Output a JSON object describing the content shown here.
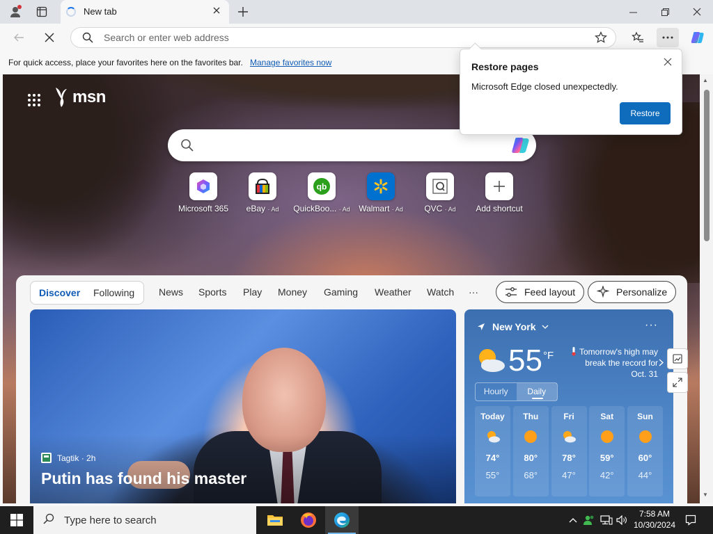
{
  "browser": {
    "tab_title": "New tab",
    "address_placeholder": "Search or enter web address",
    "favorites_hint": "For quick access, place your favorites here on the favorites bar.",
    "favorites_link": "Manage favorites now"
  },
  "restore_popup": {
    "title": "Restore pages",
    "message": "Microsoft Edge closed unexpectedly.",
    "button": "Restore"
  },
  "msn": {
    "logo_text": "msn",
    "shortcuts": [
      {
        "label": "Microsoft 365",
        "ad": "",
        "icon": "microsoft-365-icon"
      },
      {
        "label": "eBay",
        "ad": "· Ad",
        "icon": "ebay-icon"
      },
      {
        "label": "QuickBoo...",
        "ad": "· Ad",
        "icon": "quickbooks-icon"
      },
      {
        "label": "Walmart",
        "ad": "· Ad",
        "icon": "walmart-icon"
      },
      {
        "label": "QVC",
        "ad": "· Ad",
        "icon": "qvc-icon"
      },
      {
        "label": "Add shortcut",
        "ad": "",
        "icon": "plus-icon"
      }
    ]
  },
  "feed": {
    "tabs": {
      "discover": "Discover",
      "following": "Following"
    },
    "nav": [
      "News",
      "Sports",
      "Play",
      "Money",
      "Gaming",
      "Weather",
      "Watch",
      "···"
    ],
    "feed_layout": "Feed layout",
    "personalize": "Personalize",
    "hero": {
      "source": "Tagtik",
      "age": "· 2h",
      "headline": "Putin has found his master"
    }
  },
  "weather": {
    "location": "New York",
    "temp": "55",
    "unit": "°F",
    "alert": "Tomorrow's high may break the record for Oct. 31",
    "toggle": [
      "Hourly",
      "Daily"
    ],
    "forecast": [
      {
        "day": "Today",
        "hi": "74°",
        "lo": "55°",
        "icon": "partly-cloudy-icon"
      },
      {
        "day": "Thu",
        "hi": "80°",
        "lo": "68°",
        "icon": "sun-icon"
      },
      {
        "day": "Fri",
        "hi": "78°",
        "lo": "47°",
        "icon": "partly-cloudy-icon"
      },
      {
        "day": "Sat",
        "hi": "59°",
        "lo": "42°",
        "icon": "sun-icon"
      },
      {
        "day": "Sun",
        "hi": "60°",
        "lo": "44°",
        "icon": "sun-icon"
      }
    ]
  },
  "taskbar": {
    "search_placeholder": "Type here to search",
    "time": "7:58 AM",
    "date": "10/30/2024"
  },
  "colors": {
    "accent": "#0f6cbd",
    "link": "#0f5bb5",
    "taskbar": "#1f1f1f"
  }
}
